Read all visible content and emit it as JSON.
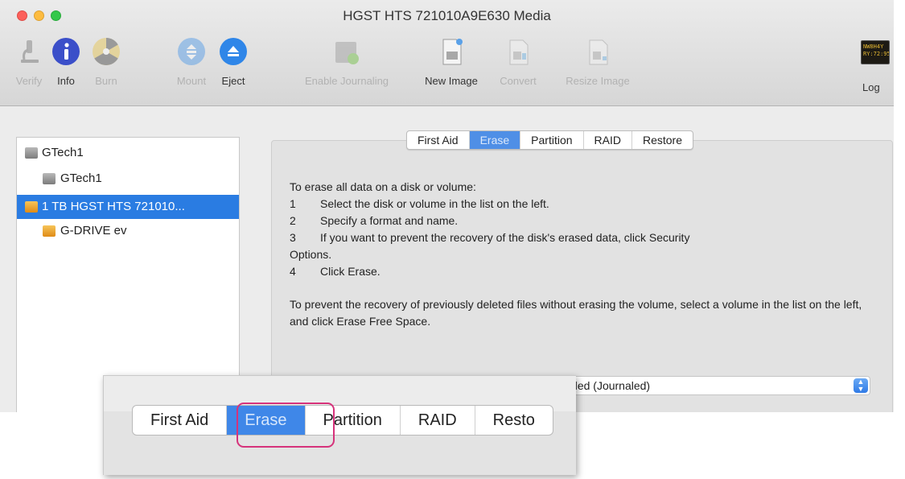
{
  "window": {
    "title": "HGST HTS 721010A9E630 Media"
  },
  "toolbar": {
    "verify": "Verify",
    "info": "Info",
    "burn": "Burn",
    "mount": "Mount",
    "eject": "Eject",
    "enable_journaling": "Enable Journaling",
    "new_image": "New Image",
    "convert": "Convert",
    "resize_image": "Resize Image",
    "log": "Log",
    "log_icon_text": "NW8H4Y\nRY:72:95"
  },
  "sidebar": {
    "items": [
      {
        "label": "GTech1"
      },
      {
        "label": "GTech1"
      },
      {
        "label": "1 TB HGST HTS 721010..."
      },
      {
        "label": "G-DRIVE ev"
      }
    ]
  },
  "tabs": [
    "First Aid",
    "Erase",
    "Partition",
    "RAID",
    "Restore"
  ],
  "erase": {
    "intro": "To erase all data on a disk or volume:",
    "steps": [
      {
        "num": "1",
        "text": "Select the disk or volume in the list on the left."
      },
      {
        "num": "2",
        "text": "Specify a format and name."
      },
      {
        "num": "3",
        "text": "If you want to prevent the recovery of the disk's erased data, click Security"
      },
      {
        "num": "4",
        "text": "Click Erase."
      }
    ],
    "step3_continuation": "Options.",
    "free_space_note": "To prevent the recovery of previously deleted files without erasing the volume, select a volume in the list on the left, and click Erase Free Space.",
    "format_value": "S Extended (Journaled)"
  },
  "zoom": {
    "tabs": [
      "First Aid",
      "Erase",
      "Partition",
      "RAID",
      "Resto"
    ]
  },
  "colors": {
    "selection": "#2a7ce2",
    "active_tab": "#4f8fe6",
    "highlight": "#d6337b"
  }
}
